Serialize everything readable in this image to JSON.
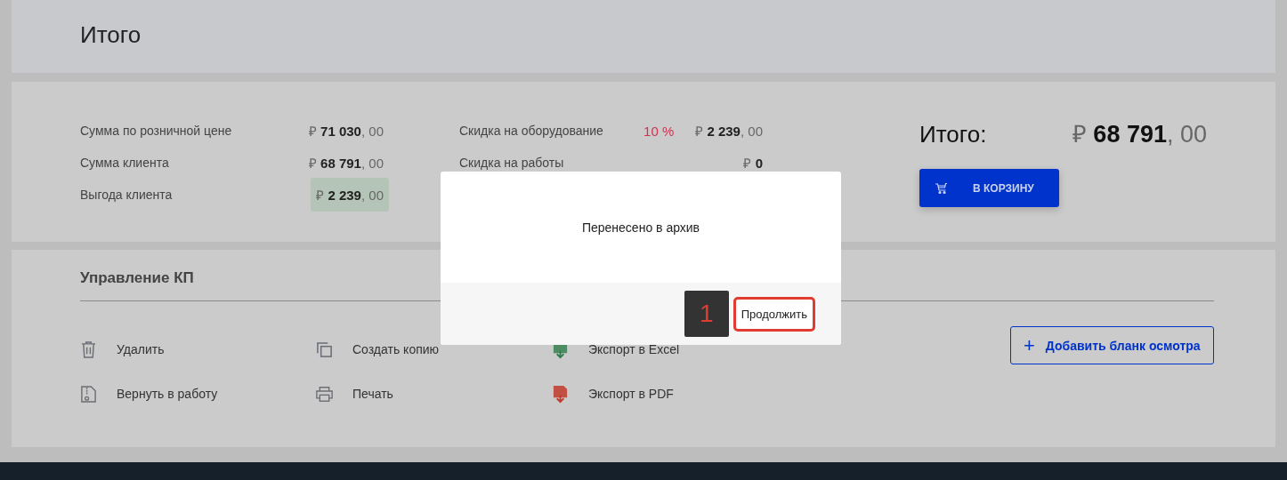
{
  "header": {
    "title": "Итого"
  },
  "summary": {
    "left": [
      {
        "label": "Сумма по розничной цене",
        "amount": "₽ **71 030**, 00",
        "highlighted": false
      },
      {
        "label": "Сумма клиента",
        "amount": "₽ **68 791**, 00",
        "highlighted": false
      },
      {
        "label": "Выгода клиента",
        "amount": "₽ **2 239**, 00",
        "highlighted": true
      }
    ],
    "middle": [
      {
        "label": "Скидка на оборудование",
        "percent": "10 %",
        "amount": "₽ **2 239**, 00"
      },
      {
        "label": "Скидка на работы",
        "amount": "₽ **0**"
      }
    ],
    "total": {
      "label": "Итого:",
      "amount": "₽ **68 791**, 00"
    },
    "cart_button": "В КОРЗИНУ"
  },
  "management": {
    "title": "Управление КП",
    "actions": [
      {
        "label": "Удалить",
        "kind": "trash"
      },
      {
        "label": "Создать копию",
        "kind": "copy"
      },
      {
        "label": "Экспорт в Excel",
        "kind": "excel"
      },
      {
        "label": "Вернуть в работу",
        "kind": "unarchive"
      },
      {
        "label": "Печать",
        "kind": "print"
      },
      {
        "label": "Экспорт в PDF",
        "kind": "pdf"
      }
    ],
    "add_button": {
      "icon": "+",
      "label": "Добавить бланк осмотра"
    }
  },
  "dialog": {
    "message": "Перенесено в архив",
    "step_badge": "1",
    "button": "Продолжить"
  }
}
